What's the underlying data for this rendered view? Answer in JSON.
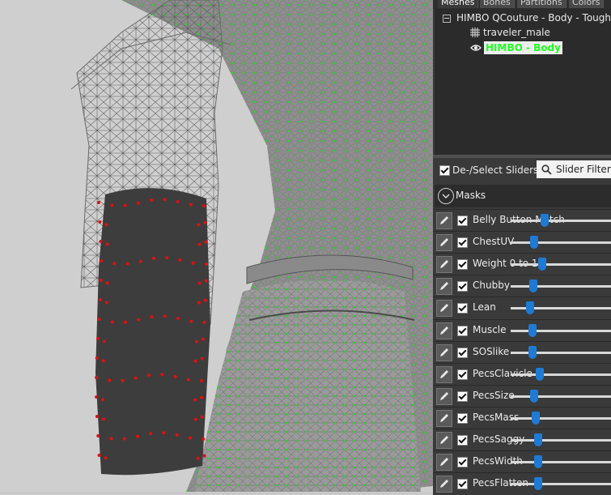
{
  "panel": {
    "tabs": [
      {
        "label": "Meshes",
        "active": true
      },
      {
        "label": "Bones",
        "active": false
      },
      {
        "label": "Partitions",
        "active": false
      },
      {
        "label": "Colors",
        "active": false
      }
    ],
    "tree": {
      "root": "HIMBO QCouture - Body - Toughen",
      "children": [
        {
          "label": "traveler_male",
          "icon": "grid-mesh-icon"
        },
        {
          "label": "HIMBO - Body",
          "icon": "eye-icon",
          "selected": true
        }
      ]
    },
    "toolbar": {
      "select_label": "De-/Select Sliders",
      "filter_label": "Slider Filter"
    },
    "masks_label": "Masks",
    "sliders": [
      {
        "label": "Belly Button Match",
        "value": 0.62
      },
      {
        "label": "ChestUV",
        "value": 0.4
      },
      {
        "label": "Weight 0 to 1",
        "value": 0.56
      },
      {
        "label": "Chubby",
        "value": 0.38
      },
      {
        "label": "Lean",
        "value": 0.31
      },
      {
        "label": "Muscle",
        "value": 0.36
      },
      {
        "label": "SOSlike",
        "value": 0.37
      },
      {
        "label": "PecsClavicle",
        "value": 0.52
      },
      {
        "label": "PecsSize",
        "value": 0.4
      },
      {
        "label": "PecsMass",
        "value": 0.43
      },
      {
        "label": "PecsSaggy",
        "value": 0.48
      },
      {
        "label": "PecsWidth",
        "value": 0.48
      },
      {
        "label": "PecsFlatten",
        "value": 0.49
      }
    ]
  },
  "colors": {
    "accent": "#1f7ad4",
    "selected_text": "#22ff22",
    "wire": "#787878",
    "vertex_green": "#22dd22",
    "vertex_red": "#e01010"
  }
}
